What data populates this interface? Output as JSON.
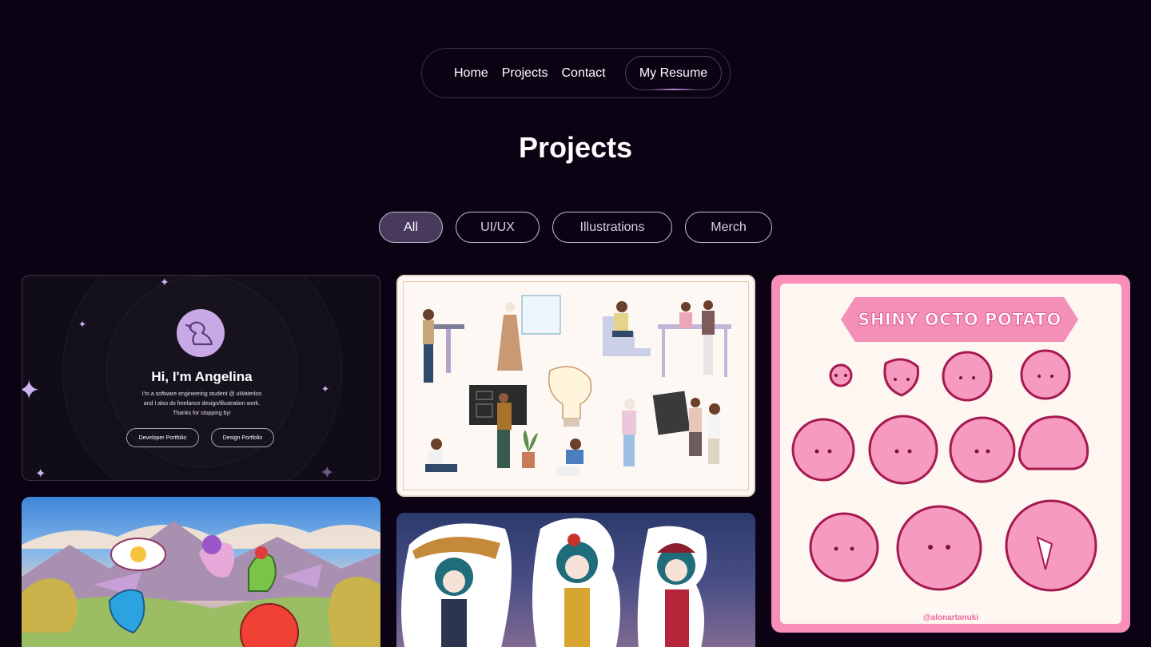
{
  "nav": {
    "items": [
      "Home",
      "Projects",
      "Contact"
    ],
    "resume_label": "My Resume"
  },
  "page": {
    "title": "Projects"
  },
  "filters": [
    {
      "label": "All",
      "active": true
    },
    {
      "label": "UI/UX",
      "active": false
    },
    {
      "label": "Illustrations",
      "active": false
    },
    {
      "label": "Merch",
      "active": false
    }
  ],
  "portfolio_card": {
    "heading": "Hi, I'm Angelina",
    "intro_line1": "I'm a software engineering student @ uWaterloo",
    "intro_line2": "and I also do freelance design/illustration work.",
    "intro_line3": "Thanks for stopping by!",
    "developer_button": "Developer Portfolio",
    "design_button": "Design Portfolio"
  },
  "sticker_sheet": {
    "title": "SHINY OCTO POTATO",
    "credit": "@alonartanuki"
  },
  "colors": {
    "background": "#0b0313",
    "active_filter": "#483a5c",
    "sticker_pink": "#f78fb8"
  }
}
